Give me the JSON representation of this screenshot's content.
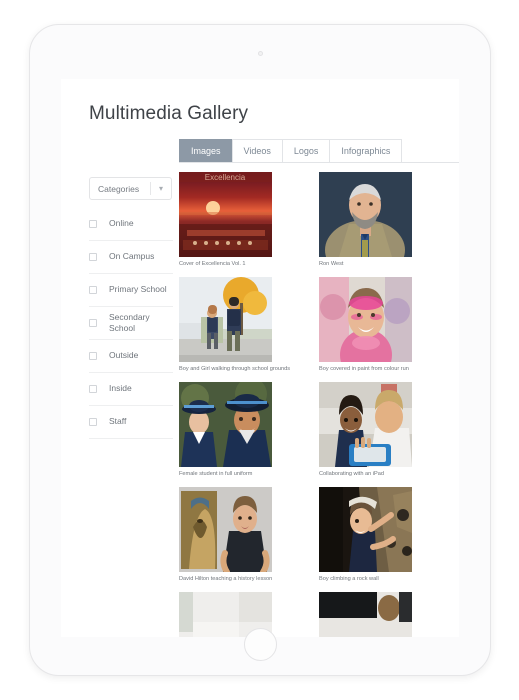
{
  "device": {
    "type": "tablet",
    "camera_icon": "camera-dot-icon",
    "home_button_icon": "home-button-icon"
  },
  "page": {
    "title": "Multimedia Gallery"
  },
  "sidebar": {
    "dropdown": {
      "label": "Categories",
      "chevron_icon": "chevron-down-icon"
    },
    "filters": [
      {
        "label": "Online",
        "checked": false
      },
      {
        "label": "On Campus",
        "checked": false
      },
      {
        "label": "Primary School",
        "checked": false
      },
      {
        "label": "Secondary School",
        "checked": false
      },
      {
        "label": "Outside",
        "checked": false
      },
      {
        "label": "Inside",
        "checked": false
      },
      {
        "label": "Staff",
        "checked": false
      }
    ]
  },
  "tabs": [
    {
      "label": "Images",
      "active": true
    },
    {
      "label": "Videos",
      "active": false
    },
    {
      "label": "Logos",
      "active": false
    },
    {
      "label": "Infographics",
      "active": false
    }
  ],
  "gallery": {
    "items": [
      {
        "caption": "Cover of Excellencia Vol. 1",
        "alt": "magazine-cover-sunset-red"
      },
      {
        "caption": "Ron West",
        "alt": "portrait-bearded-man-tan-jacket"
      },
      {
        "caption": "Boy and Girl walking through school grounds",
        "alt": "two-students-backpacks-autumn-tree"
      },
      {
        "caption": "Boy covered in paint from colour run",
        "alt": "child-pink-paint-smiling"
      },
      {
        "caption": "Female student in full uniform",
        "alt": "students-navy-uniform-wide-brim-hats"
      },
      {
        "caption": "Collaborating with an iPad",
        "alt": "two-children-blue-ipad"
      },
      {
        "caption": "David Hilton teaching a history lesson",
        "alt": "teacher-dark-shirt-egyptian-pharaoh"
      },
      {
        "caption": "Boy climbing a rock wall",
        "alt": "boy-climbing-rock-wall"
      },
      {
        "caption": "",
        "alt": "partially-visible-white-room"
      },
      {
        "caption": "",
        "alt": "partially-visible-dark-screen"
      }
    ]
  },
  "colors": {
    "active_tab": "#8d99a6",
    "title_text": "#3f4348",
    "body_text": "#6f757c",
    "border": "#e2e4e7"
  }
}
